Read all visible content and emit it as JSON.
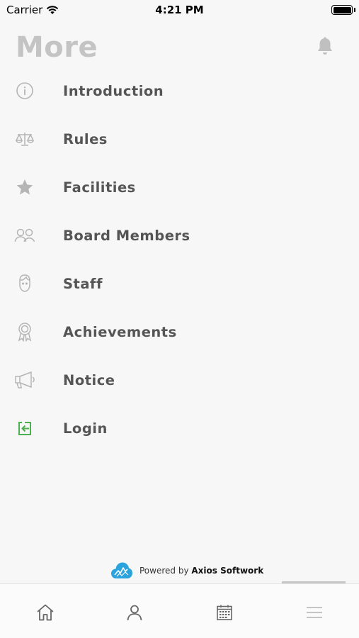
{
  "status_bar": {
    "carrier": "Carrier",
    "time": "4:21 PM",
    "wifi_icon": "wifi-icon",
    "battery_icon": "battery-icon"
  },
  "header": {
    "title": "More",
    "notification_icon": "bell-icon"
  },
  "menu": {
    "items": [
      {
        "label": "Introduction",
        "icon": "info-circle-icon"
      },
      {
        "label": "Rules",
        "icon": "scales-icon"
      },
      {
        "label": "Facilities",
        "icon": "star-icon"
      },
      {
        "label": "Board Members",
        "icon": "users-icon"
      },
      {
        "label": "Staff",
        "icon": "face-icon"
      },
      {
        "label": "Achievements",
        "icon": "award-icon"
      },
      {
        "label": "Notice",
        "icon": "megaphone-icon"
      },
      {
        "label": "Login",
        "icon": "login-icon"
      }
    ]
  },
  "footer": {
    "powered_prefix": "Powered by",
    "company": "Axios Softwork",
    "logo_icon": "cloud-logo-icon"
  },
  "tabbar": {
    "tabs": [
      {
        "icon": "home-icon"
      },
      {
        "icon": "person-icon"
      },
      {
        "icon": "calendar-icon"
      },
      {
        "icon": "menu-icon"
      }
    ],
    "active_index": 3
  },
  "colors": {
    "icon_gray": "#b5b5b5",
    "login_green": "#4caf50",
    "title_gray": "#c4c4c4",
    "label": "#555555",
    "brand_blue": "#2ba3dc"
  }
}
